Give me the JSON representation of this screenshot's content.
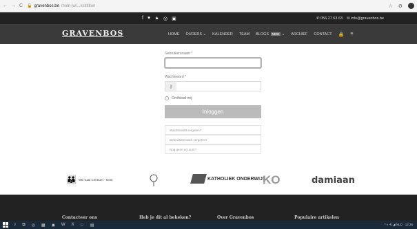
{
  "browser": {
    "nav": {
      "back": "←",
      "forward": "→",
      "reload": "C"
    },
    "url_host": "gravenbos.be",
    "url_path": "/mon-jw/...kstitition",
    "star": "☆",
    "extension": "⚙"
  },
  "topbar": {
    "social_icons": [
      "f",
      "♥",
      "▲",
      "◎",
      "▣"
    ],
    "phone": "✆ 056 27 63 63",
    "email": "✉ info@gravenbos.be"
  },
  "nav": {
    "logo": "GRAVENBOS",
    "items": [
      {
        "label": "HOME"
      },
      {
        "label": "OUDERS ⌄"
      },
      {
        "label": "KALENDER"
      },
      {
        "label": "TEAM"
      },
      {
        "label": "BLOGS",
        "badge": "NEW",
        "suffix": " ⌄"
      },
      {
        "label": "ARCHIEF"
      },
      {
        "label": "CONTACT"
      }
    ],
    "lock_icon": "🔒",
    "menu_icon": "≡"
  },
  "login": {
    "username_label": "Gebruikersnaam *",
    "password_label": "Wachtwoord *",
    "key_icon": "⚷",
    "remember_label": "Onthoud mij",
    "submit_label": "Inloggen",
    "links": [
      "Wachtwoord vergeten?",
      "Gebruikersnaam vergeten?",
      "Nog geen account?"
    ]
  },
  "partners": {
    "p1": "WE.CLB Centrum - Gent",
    "p3": "KATHOLIEK ONDERWIJS",
    "p4": "KO",
    "p5": "damiaan"
  },
  "footer": {
    "headings": [
      "Contacteer ons",
      "Heb je dit al bekeken?",
      "Over Gravenbos",
      "Populaire artikelen"
    ]
  },
  "taskbar": {
    "apps": [
      "⌕",
      "⧉",
      "◎",
      "▦",
      "◉",
      "W",
      "X",
      "⚐",
      "▤"
    ],
    "tray": "^ ◐ ⟲ ◢ NLD",
    "time": "12:25"
  }
}
